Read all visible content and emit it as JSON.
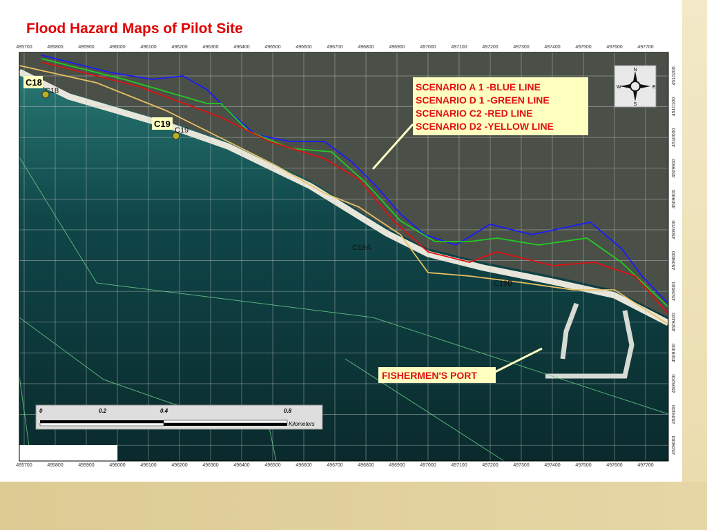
{
  "slide": {
    "title": "Flood Hazard Maps of Pilot Site"
  },
  "map": {
    "easting_ticks": [
      "495700",
      "495800",
      "495900",
      "496000",
      "496100",
      "496200",
      "496300",
      "496400",
      "496500",
      "496600",
      "496700",
      "496800",
      "496900",
      "497000",
      "497100",
      "497200",
      "497300",
      "497400",
      "497500",
      "497600",
      "497700"
    ],
    "northing_ticks": [
      "4510200",
      "4510100",
      "4510000",
      "4509900",
      "4509800",
      "4509700",
      "4509600",
      "4509500",
      "4509400",
      "4509300",
      "4509200",
      "4509100",
      "4509000"
    ],
    "legend": [
      {
        "text": "SCENARIO  A 1 -BLUE LINE",
        "color": "#1a1aff"
      },
      {
        "text": "SCENARIO  D 1 -GREEN LINE",
        "color": "#22cc22"
      },
      {
        "text": "SCENARIO  C2   -RED LINE",
        "color": "#e01010"
      },
      {
        "text": "SCENARIO  D2  -YELLOW LINE",
        "color": "#e8c060"
      }
    ],
    "legend_text_color": "#e01010",
    "points": [
      {
        "tag": "C18",
        "label": "C18"
      },
      {
        "tag": "C19",
        "label": "C19"
      }
    ],
    "labels": {
      "c19a": "C19A",
      "c19b": "C19B",
      "port": "FISHERMEN'S PORT"
    },
    "compass": {
      "n": "N",
      "s": "S",
      "e": "E",
      "w": "W"
    },
    "scale_bar": {
      "ticks": [
        "0",
        "0.2",
        "0.4",
        "0.8"
      ],
      "unit": "Kilometers"
    }
  }
}
